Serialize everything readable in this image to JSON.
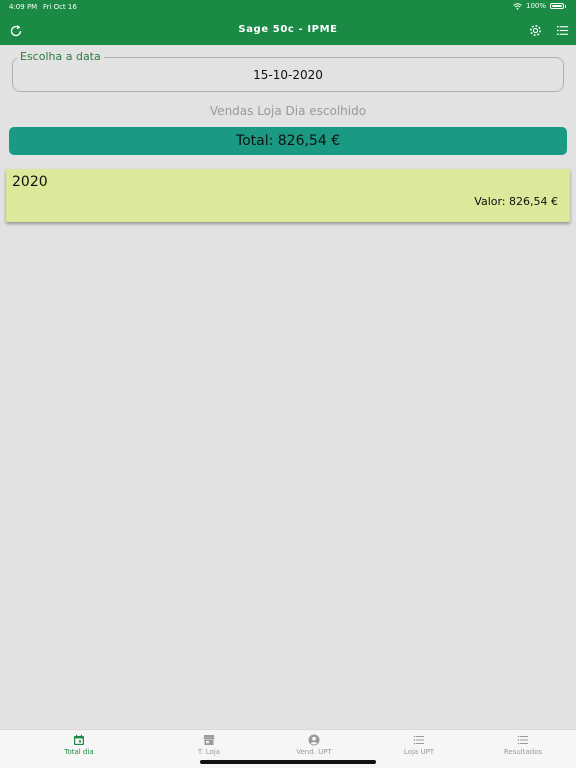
{
  "status_bar": {
    "time": "4:09 PM",
    "date": "Fri Oct 16",
    "battery": "100%"
  },
  "header": {
    "title": "Sage 50c - IPME"
  },
  "date_field": {
    "label": "Escolha a data",
    "value": "15-10-2020"
  },
  "subtitle": "Vendas Loja Dia escolhido",
  "total": {
    "text": "Total: 826,54 €"
  },
  "year_card": {
    "year": "2020",
    "value": "Valor: 826,54 €"
  },
  "tabs": [
    {
      "label": "Total dia",
      "icon": "calendar-icon",
      "active": true
    },
    {
      "label": "T. Loja",
      "icon": "store-icon",
      "active": false
    },
    {
      "label": "Vend. UPT",
      "icon": "person-icon",
      "active": false
    },
    {
      "label": "Loja UPT",
      "icon": "list-icon",
      "active": false
    },
    {
      "label": "Resultados",
      "icon": "list-icon",
      "active": false
    }
  ],
  "colors": {
    "header": "#1b8a45",
    "total_bar": "#1a9a83",
    "card": "#dce99a",
    "background": "#e2e2e2"
  }
}
